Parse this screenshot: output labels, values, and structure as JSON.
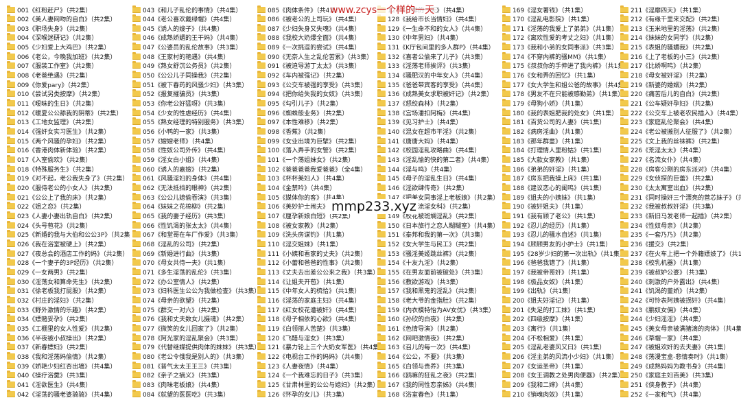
{
  "watermarks": {
    "top": "www.zcys一个样的一天",
    "middle": "mmp233.xyz"
  },
  "columns": [
    {
      "items": [
        "001《红粉赶尸》（共2集）",
        "002《美人妻网吻的自白》（共2集）",
        "003《职场失身》（共2集）",
        "004《深喉迷研记》（共2集）",
        "005《少妇爱上大鸡巴》（共2集）",
        "006《老公，今晚我加班》（共2集）",
        "007《服装工作室》（共2集）",
        "008《老爸绝遇》（共2集）",
        "009《你爱pary》（共2集）",
        "010《尝试另类按摩》（共2集）",
        "011《暧昧的生日》（共2集）",
        "012《暖夏公公舔我的阴蒂》（共2集）",
        "013《工地女监理》（共2集）",
        "014《强奸女实习医生》（共2集）",
        "015《两个风骚的孕妇》（共2集）",
        "016《香港肉体新体验》（共2集）",
        "017《入室偷欢》（共2集）",
        "018《特殊服务生》（共2集）",
        "019《对不起，老公我失身了》（共2集）",
        "020《服侍老公的小女人》（共2集）",
        "021《公公上了我的床》（共2集）",
        "022《姐之恋》（共2集）",
        "023《人妻小妻出轨自白》（共2集）",
        "024《头号苞花》（共2集）",
        "025《新婚的我与大伯和公公3P》（共2集）",
        "026《我在浴室被硬上》（共2集）",
        "027《夜总会的酒店工作的妈》（共2集）",
        "028《一个妻子的3P经历》（共2集）",
        "029《一女两男》（共2集）",
        "030《淫荡女和算命先生》（共2集）",
        "031《徐老板我打屁股》（共2集）",
        "032《村庄的淫妇》（共2集）",
        "033《野外激情的乐趣》（共2集）",
        "034《嫖赌妥孕》（共2集）",
        "035《工棚里的女人性爱》（共2集）",
        "036《半夜被小叔操出》（共2集）",
        "037《新春嫖妇》（共2集）",
        "038《我和淫荡妈偷情》（共2集）",
        "039《娇艳少妇红杏出墙》（共4集）",
        "040《操疗浴羹》（共3集）",
        "041《淫欲医生》（共4集）",
        "042《淫荡的骚老婆骑骑》（共4集）"
      ]
    },
    {
      "items": [
        "043《和儿子乱伦的事情》（共4集）",
        "044《老公喜欢戴绿帽》（共4集）",
        "045《诱人的嫂子》（共4集）",
        "046《成熟娇媚的王干妈》（共4集）",
        "047《公婆员的乱伦故事》（共3集）",
        "048《王家村的艳遇》（共4集）",
        "049《熟女舒沉公务员》（共2集）",
        "050《公公儿子同操我》（共2集）",
        "051《被下春药的风骚少妇》（共3集）",
        "052《报复摧骗员》（共3集）",
        "053《你老公好猛呀》（共3集）",
        "054《少女的性虐经历》（共4集）",
        "055《熟女经理的特别服务》（共3集）",
        "056《小鸭的一家》（共3集）",
        "057《嫂嫂老师》（共4集）",
        "058《性奴公司外传》（共4集）",
        "059《淫女白小姐》（共4集）",
        "060《诱人的嘉嫂》（共2集）",
        "061《风骚淫妇的身体》（共4集）",
        "062《无法抵挡的眼神》（共2集）",
        "063《公公儿媳偷吞演》（共3集）",
        "064《妹妹之花棉柳》（共2集）",
        "065《我的妻子经历》（共3集）",
        "066《性饥渴的张太太》（共4集）",
        "067《和堂哥在车厂作爱》（共3集）",
        "068《淫乱的公司》（共2集）",
        "069《新婚进行曲》（共3集）",
        "070《母女共侍一夫》（共1集）",
        "071《多生淫荡的乱伦》（共3集）",
        "072《办公室情人》（共2集）",
        "073《妇科医生公公为我做检查》（共3集）",
        "074《母亲的欲望》（共2集）",
        "075《群交一对六》（共2集）",
        "076《我和丈夫数女儿摄魂》（共2集）",
        "077《微笑的女儿回家了》（共2集）",
        "078《阿光家的淫乱聚会》（共3集）",
        "079《代替继媒提供肉体的妹妹》（共3集）",
        "080《老公令俄我是别人的》（共3集）",
        "081《普气太太王王三》（共3集）",
        "082《亲子之摘义》（共3集）",
        "083《肉味老板娘》（共4集）",
        "084《就望的医医吃》（共3集）"
      ]
    },
    {
      "items": [
        "085《肉体条件》（共4集）",
        "086《被老公的上司玩》（共4集）",
        "087《少妇失身又失魂》（共4集）",
        "088《我校大奶爆全面》（共4集）",
        "089《一次挑逗的尝试》（共4集）",
        "090《无奈人生之乱伦苦累》（共3集）",
        "091《被迫导游丁太太》（共3集）",
        "092《车内被强记》（共2集）",
        "093《公交车被强的享受》（共3集）",
        "094《把你给失我的女奴》（共3集）",
        "095《勾引儿子》（共2集）",
        "096《蜘蛛般业务》（共2集）",
        "097《本性难移》（共2集）",
        "098《香蕉》（共2集）",
        "099《女业出境为巨擘》（共2集）",
        "100《落入弄手的女警》（共2集）",
        "101《一个荡姐妹女》（共2集）",
        "102《爸爸爸爸我爱爸爸》（全4集）",
        "103《杯杯美妇人》（共4集）",
        "104《金禁吟》（共4集）",
        "105《媒体你的客》（共4集）",
        "106《美妙护士闹夫》（共3集）",
        "107《厘孕新娘白短》（共2集）",
        "108《被女家教》（共2集）",
        "109《洗头房谋钓》（共1集）",
        "110《淫交姐妹》（共1集）",
        "111《小姨和看家的丈夫》（共2集）",
        "112《小蕾和爸爸的性事》（共2集）",
        "113《丈夫去出差公公来之我》（共3集）",
        "114《让姐夫开苞》（共1集）",
        "115《中年女人的梳恰》（共1集）",
        "116《淫荡的家庭主妇》（共4集）",
        "117《红女校花遭被奸》（共4集）",
        "118《母子相依的心欲》（共4集）",
        "119《白领丽人苦楚》（共3集）",
        "120《飞醋与淫女》（共3集）",
        "121《暴力轮上三个大奶女军医》（共4集）",
        "122《电视台工作的妈妈》（共4集）",
        "123《人妻夜情》（共4集）",
        "124《一个我难忘的日子》（共3集）",
        "125《甘肃林里的公公与媳妇》（共2集）",
        "126《怀孕的女儿》（共3集）"
      ]
    },
    {
      "items": [
        "127《一样的一天》（共4集）",
        "128《我给市长当情妇》（共4集）",
        "129《一生命不和的女人》（共4集）",
        "130《中年男妇》（共4集）",
        "131《K厅包间里的多人群P》（共4集）",
        "132《喜者公偷来了儿子》（共3集）",
        "133《淫荡老师挨评》（共3集）",
        "134《骚肥汉的中年女人》（共4集）",
        "135《爸爸带宾客的享受》（共4集）",
        "136《成熟美女求职被奸记》（共2集）",
        "137《怒绞森林》（共2集）",
        "138《宫场潘扣阿梅》（共4集）",
        "139《见习护士》（共4集）",
        "140《混女在超市平淫》（共2集）",
        "141《唐唐大妈》（共4集）",
        "142《校园淫乱攻略曲》（共4集）",
        "143《淫乱愉的快的第二者》（共4集）",
        "144《淫与鸣》（共4集）",
        "145《母子的淫乱生日》（共4集）",
        "146《淫欲肆传奇》（共2集）",
        "147《把美女同事淫上老板娘》（共2集）",
        "148《夏日流淫女科》（共2集）",
        "149《校花被斑斓淫乱》（共2集）",
        "150《日本旅行之恋人糊糊室》（共4集）",
        "151《泰邦和我的第一次》（共3集）",
        "152《女大学生与民工》（共2集）",
        "153《骚淫美姬跳丝裤》（共2集）",
        "154《十友九淫》（共2集）",
        "155《在男友面前被破处》（共3集）",
        "156《教欲游戏》（共3集）",
        "157《我和黑鬼的淫乱》（共2集）",
        "158《老大爷的金指肚》（共2集）",
        "159《内衣模特怡为AV女优》（共3集）",
        "160《孙欣的白夜》（共2集）",
        "161《色情导演》（共2集）",
        "162《网吧激情夜》（共2集）",
        "163《召儿的每一次》（共4集）",
        "164《公公，不要》（共3集）",
        "165《白领与贵养》（共3集）",
        "166《鸥嘛的狂乱之夜》（共2集）",
        "167《我的同性恋亲姊》（共4集）",
        "168《浴室春色》（共1集）"
      ]
    },
    {
      "items": [
        "169《淫女著钱》（共1集）",
        "170《淫乱电影院》（共1集）",
        "171《淫荡的我爱上了弟弟》（共1集）",
        "172《离欢性爱的考丈之妇》（共1集）",
        "173《我和小弟的女同事派》（共3集）",
        "174《不穿内裤的骚MM》（共1集）",
        "175《叔叔你的手伸进了我内裤》（共1集）",
        "176《女和弄的回忆》（共1集）",
        "177《女大学生和姐公爸的故事》（共4集）",
        "178《男友不在只能被感勤弟》（共1集）",
        "179《母狗小娇》（共1集）",
        "180《我的表姐肥我的处女》（共1集）",
        "181《百货公司的人妻》（共1集）",
        "182《病房淫曲》（共1集）",
        "183《那年群童》（共1集）",
        "184《打理情人里粉姑》（共1集）",
        "185《大款女家教》（共1集）",
        "186《弟弟的奸淫》（共1集）",
        "187《房东把我操上床》（共1集）",
        "188《建议恋心的闺鸣》（共1集）",
        "189《姐夫的小姨妹》（共1集）",
        "190《被奸姐夫》（共1集）",
        "191《我有顾了老公》（共1集）",
        "192《忍儿的经历》（共1集）",
        "193《忍儿的骚水自述》（共1集）",
        "194《顾顾男友的小护士》（共1集）",
        "195《28岁少妇的第一次出轨》（共1集）",
        "196《爸爸我错了》（共1集）",
        "197《我被帝哥奸》（共1集）",
        "198《极品女奴》（共1集）",
        "199《出轨》（共1集）",
        "200《姐夫好淫记》（共1集）",
        "201《失足的打工妹》（共1集）",
        "202《四级按摩》（共1集）",
        "203《寓行》（共1集）",
        "204《不松相爱》（共1集）",
        "205《淫乱老婆风又曰》（共1集）",
        "206《淫主弟的风流小少妇》（共1集）",
        "207《女运圣帝》（共1集）",
        "208《女王调教之处男肉便器》（共2集）",
        "209《我和二婶》（共4集）",
        "210《销魂肉奴》（共1集）"
      ]
    },
    {
      "items": [
        "211《淫靡四天》（共1集）",
        "212《有缘千里来交配》（共2集）",
        "213《玉米地里的淫荡》（共2集）",
        "214《妹妹的女同学》（共2集）",
        "215《表姐的骚媚我》（共2集）",
        "216《上了老板的小三》（共2集）",
        "217《比娇啊鸣》（共2集）",
        "218《母女被奸淫》（共2集）",
        "219《新婆的婚姻》（共2集）",
        "220《痛苦后儿的自白》（共2集）",
        "221《公车疑奸孕妇》（共2集）",
        "222《公交车上被老农民插入》（共4集）",
        "223《家庭乱伦聚会》（共4集）",
        "224《老公被搬别人征服了》（共2集）",
        "225《文上我的丝袜裤》（共2集）",
        "226《荒淫太太》（共4集）",
        "227《名流女仆》（共4集）",
        "228《房客公刚的房东派对》（共4集）",
        "229《女侦探的巨蕾》（共2集）",
        "230《太太寓室出血》（共2集）",
        "231《同时操奸三个漂亮的营芯妹子》（共2集）",
        "232《我被叔叔奸淫》（共3集）",
        "233《新旧马发老师一起插》（共2集）",
        "234《性奴母亲》（共2集）",
        "235《一套乃乃》（共2集）",
        "236《援交》（共2集）",
        "237《在火车上把一个外籍嫖妓了》（共1集）",
        "238《校乳机器》（共1集）",
        "239《被叔妒公婆》（共3集）",
        "240《刺激的户外露出》（共4集）",
        "241《饥渴的董娇》（共2集）",
        "242《可怜表阿姨被拐奸》（共4集）",
        "243《鹏奴女佣》（共4集）",
        "244《少妇淫淫》（共4集）",
        "245《美女母亲被满猪滴的肉体》（共4集）",
        "246《草帽一家》（共4集）",
        "247《被姐欢奸的去夫妻》（共1集）",
        "248《荡漫宝盒-悲情奏时》（共1集）",
        "249《成熟妈妈为教书身》（共4集）",
        "250《家庭主妇百美》（共3集）",
        "251《侠身教子》（共4集）",
        "252《一家和气》（共4集）"
      ]
    }
  ]
}
